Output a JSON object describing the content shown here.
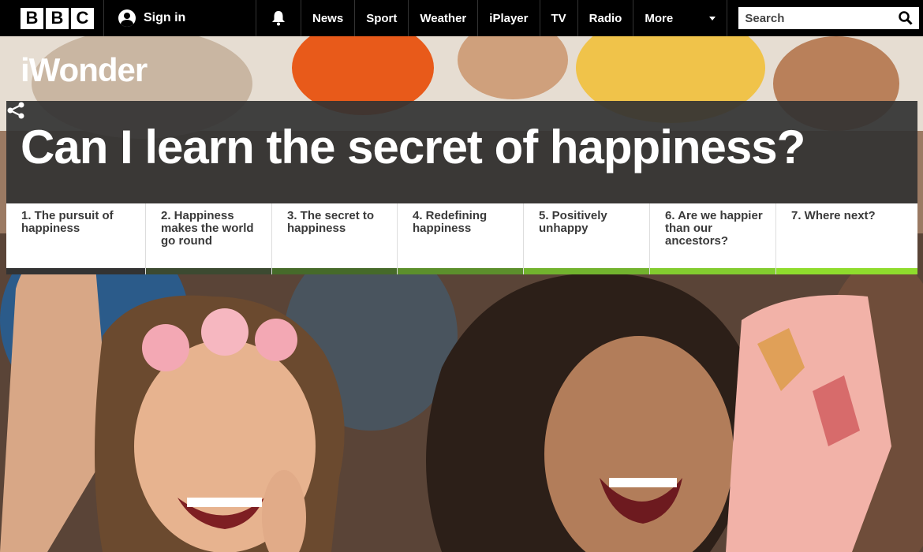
{
  "nav": {
    "logo_letters": [
      "B",
      "B",
      "C"
    ],
    "sign_in": "Sign in",
    "links": [
      "News",
      "Sport",
      "Weather",
      "iPlayer",
      "TV",
      "Radio"
    ],
    "more": "More",
    "search_placeholder": "Search"
  },
  "hero": {
    "brand": "iWonder",
    "title": "Can I learn the secret of happiness?"
  },
  "chapters": [
    {
      "label": "1. The pursuit of happiness",
      "color": "#333333"
    },
    {
      "label": "2. Happiness makes the world go round",
      "color": "#3c4a31"
    },
    {
      "label": "3. The secret to happiness",
      "color": "#466a2a"
    },
    {
      "label": "4. Redefining happiness",
      "color": "#5c8f2c"
    },
    {
      "label": "5. Positively unhappy",
      "color": "#72b32e"
    },
    {
      "label": "6. Are we happier than our ancestors?",
      "color": "#83cc2f"
    },
    {
      "label": "7. Where next?",
      "color": "#8fdc2d"
    }
  ]
}
